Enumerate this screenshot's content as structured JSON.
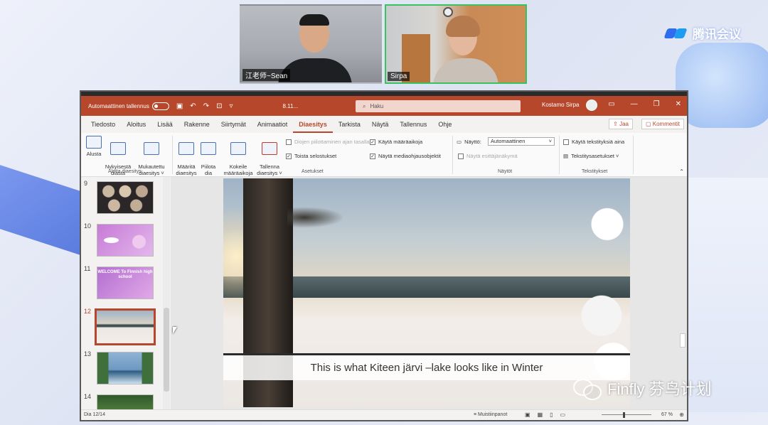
{
  "meeting": {
    "brand": "腾讯会议",
    "participants": [
      {
        "name": "江老师~Sean",
        "active": false
      },
      {
        "name": "Sirpa",
        "active": true
      }
    ],
    "watermark": "Finfly 芬鸟计划"
  },
  "ppt": {
    "titlebar": {
      "autosave_label": "Automaattinen tallennus",
      "file_name": "8.11...",
      "search_placeholder": "Haku",
      "user_name": "Kostamo Sirpa"
    },
    "tabs": [
      "Tiedosto",
      "Aloitus",
      "Lisää",
      "Rakenne",
      "Siirtymät",
      "Animaatiot",
      "Diaesitys",
      "Tarkista",
      "Näytä",
      "Tallennus",
      "Ohje"
    ],
    "active_tab": "Diaesitys",
    "share_label": "Jaa",
    "comments_label": "Kommentit",
    "ribbon": {
      "start_buttons": [
        {
          "label": "Alusta",
          "icon": "play-from-start-icon"
        },
        {
          "label": "Nykyisestä\ndiasta",
          "icon": "play-from-current-icon"
        },
        {
          "label": "Mukautettu\ndiaesitys ˅",
          "icon": "custom-show-icon"
        }
      ],
      "start_group_label": "Aloita diaesitys",
      "setup_buttons": [
        {
          "label": "Määritä\ndiaesitys",
          "icon": "setup-show-icon"
        },
        {
          "label": "Piilota\ndia",
          "icon": "hide-slide-icon"
        },
        {
          "label": "Kokeile\nmääräaikoja",
          "icon": "rehearse-timings-icon"
        },
        {
          "label": "Tallenna\ndiaesitys ˅",
          "icon": "record-show-icon"
        }
      ],
      "checks": [
        {
          "label": "Diojen piilottaminen ajan tasalla",
          "checked": false,
          "disabled": true
        },
        {
          "label": "Toista selostukset",
          "checked": true,
          "disabled": false
        },
        {
          "label": "Käytä määräaikoja",
          "checked": true,
          "disabled": false
        },
        {
          "label": "Näytä mediaohjausobjektit",
          "checked": true,
          "disabled": false
        }
      ],
      "setup_group_label": "Asetukset",
      "monitor_label": "Näyttö:",
      "monitor_value": "Automaattinen",
      "presenter_view_label": "Näytä esittäjänäkymä",
      "monitors_group_label": "Näytöt",
      "subtitles_check_label": "Käytä tekstityksiä aina",
      "subtitle_settings_label": "Tekstitysasetukset ˅",
      "subtitles_group_label": "Tekstitykset"
    },
    "thumbnails": [
      {
        "number": "9",
        "theme": "dark-collage",
        "current": false
      },
      {
        "number": "10",
        "theme": "purple",
        "current": false
      },
      {
        "number": "11",
        "theme": "purple-welcome",
        "current": false,
        "text": "WELCOME To Finnish high school"
      },
      {
        "number": "12",
        "theme": "winter-lake",
        "current": true
      },
      {
        "number": "13",
        "theme": "summer-lake",
        "current": false
      },
      {
        "number": "14",
        "theme": "forest",
        "current": false
      }
    ],
    "slide": {
      "caption": "This is what Kiteen järvi –lake looks like in Winter"
    },
    "statusbar": {
      "slide_indicator": "Dia 12/14",
      "notes_label": "Muistiinpanot",
      "zoom": "67 %"
    }
  }
}
